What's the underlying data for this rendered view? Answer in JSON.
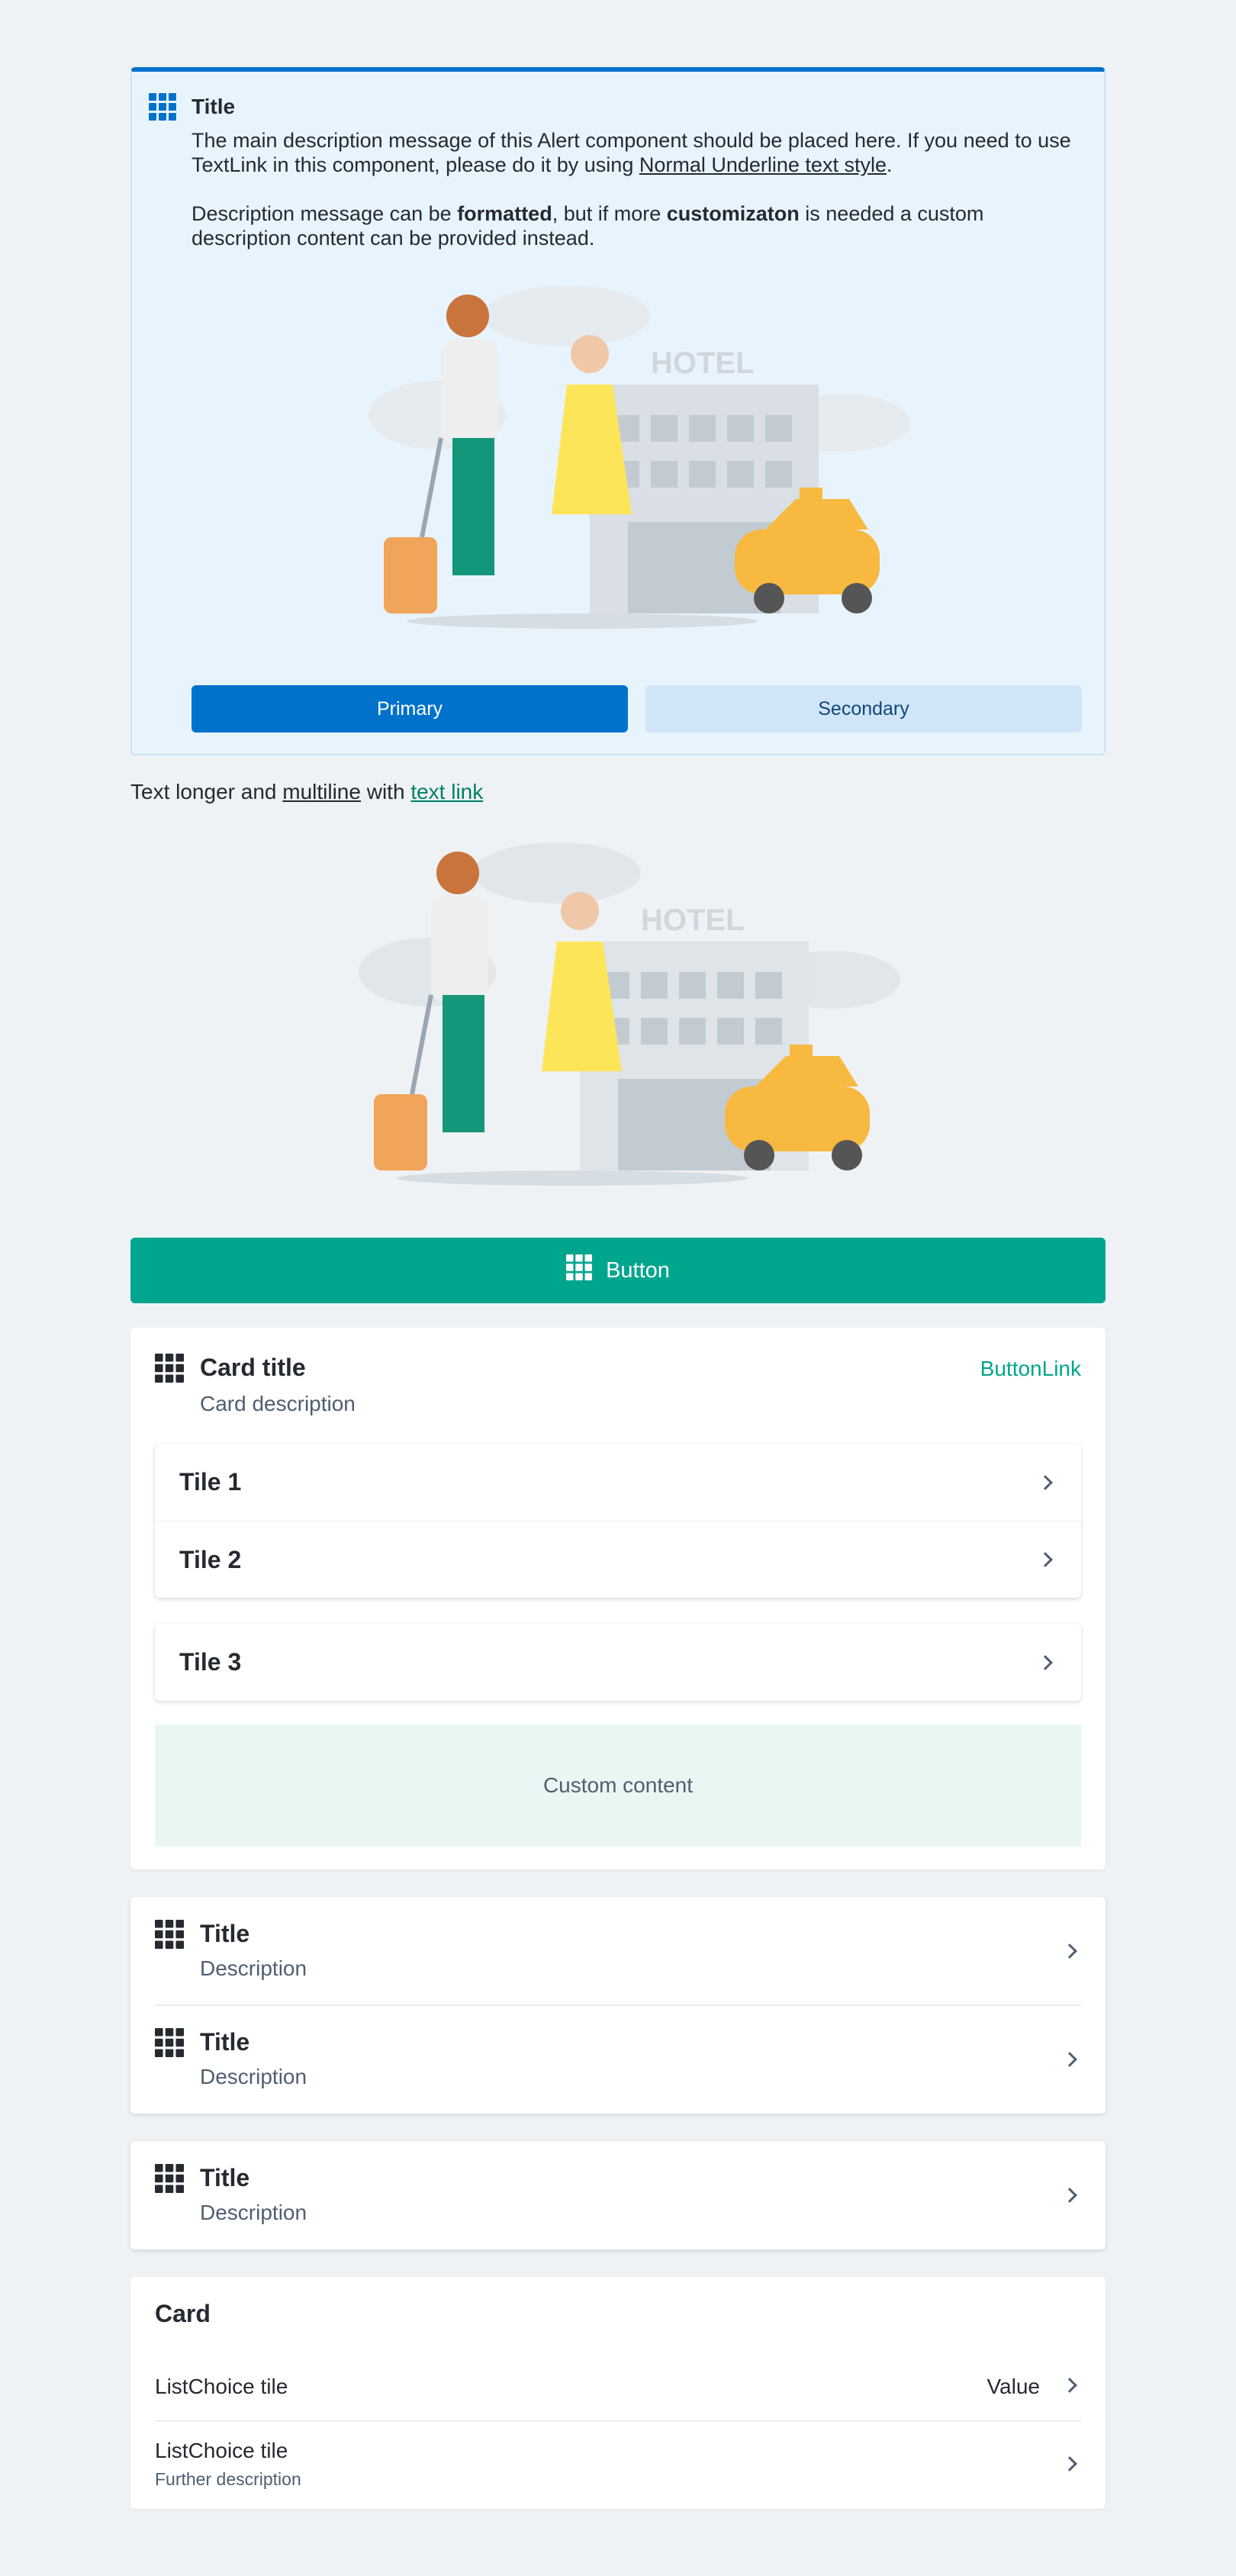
{
  "alert": {
    "icon": "grid-icon",
    "title": "Title",
    "desc1_a": "The main description message of this Alert component should be placed here. If you need to use TextLink in this component, please do it by using ",
    "desc1_link": "Normal Underline text style",
    "desc1_b": ".",
    "desc2_a": "Description message can be ",
    "desc2_bold1": "formatted",
    "desc2_b": ", but if more ",
    "desc2_bold2": "customizaton",
    "desc2_c": " is needed a custom description content can be provided instead.",
    "illustration_text": "HOTEL",
    "primary_label": "Primary",
    "secondary_label": "Secondary",
    "colors": {
      "accent": "#0172cb",
      "background": "#e8f4fd"
    }
  },
  "textline": {
    "a": "Text longer and ",
    "underline": "multiline",
    "b": " with ",
    "link": "text link"
  },
  "illustration2": {
    "text": "HOTEL"
  },
  "big_button": {
    "label": "Button",
    "icon": "grid-icon",
    "color": "#00a58e"
  },
  "card": {
    "title": "Card title",
    "description": "Card description",
    "button_link": "ButtonLink",
    "tiles": [
      {
        "label": "Tile 1"
      },
      {
        "label": "Tile 2"
      },
      {
        "label": "Tile 3"
      }
    ],
    "custom_content": "Custom content"
  },
  "list_card": {
    "rows": [
      {
        "title": "Title",
        "description": "Description"
      },
      {
        "title": "Title",
        "description": "Description"
      }
    ]
  },
  "single_card": {
    "title": "Title",
    "description": "Description"
  },
  "choice_card": {
    "title": "Card",
    "items": [
      {
        "label": "ListChoice tile",
        "value": "Value"
      },
      {
        "label": "ListChoice tile",
        "description": "Further description"
      }
    ]
  }
}
